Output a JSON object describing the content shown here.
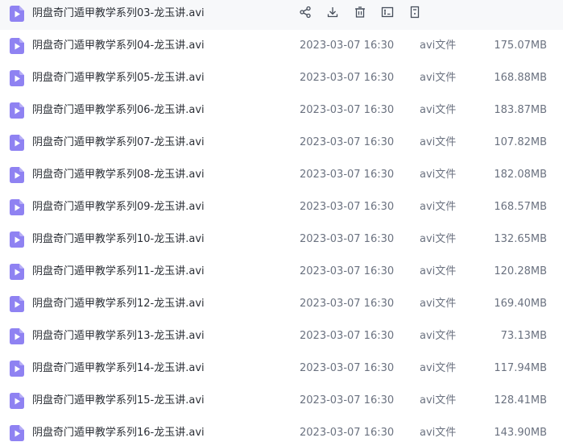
{
  "files": [
    {
      "name": "阴盘奇门遁甲教学系列03-龙玉讲.avi",
      "date": "",
      "type": "",
      "size": "",
      "hovered": true
    },
    {
      "name": "阴盘奇门遁甲教学系列04-龙玉讲.avi",
      "date": "2023-03-07 16:30",
      "type": "avi文件",
      "size": "175.07MB"
    },
    {
      "name": "阴盘奇门遁甲教学系列05-龙玉讲.avi",
      "date": "2023-03-07 16:30",
      "type": "avi文件",
      "size": "168.88MB"
    },
    {
      "name": "阴盘奇门遁甲教学系列06-龙玉讲.avi",
      "date": "2023-03-07 16:30",
      "type": "avi文件",
      "size": "183.87MB"
    },
    {
      "name": "阴盘奇门遁甲教学系列07-龙玉讲.avi",
      "date": "2023-03-07 16:30",
      "type": "avi文件",
      "size": "107.82MB"
    },
    {
      "name": "阴盘奇门遁甲教学系列08-龙玉讲.avi",
      "date": "2023-03-07 16:30",
      "type": "avi文件",
      "size": "182.08MB"
    },
    {
      "name": "阴盘奇门遁甲教学系列09-龙玉讲.avi",
      "date": "2023-03-07 16:30",
      "type": "avi文件",
      "size": "168.57MB"
    },
    {
      "name": "阴盘奇门遁甲教学系列10-龙玉讲.avi",
      "date": "2023-03-07 16:30",
      "type": "avi文件",
      "size": "132.65MB"
    },
    {
      "name": "阴盘奇门遁甲教学系列11-龙玉讲.avi",
      "date": "2023-03-07 16:30",
      "type": "avi文件",
      "size": "120.28MB"
    },
    {
      "name": "阴盘奇门遁甲教学系列12-龙玉讲.avi",
      "date": "2023-03-07 16:30",
      "type": "avi文件",
      "size": "169.40MB"
    },
    {
      "name": "阴盘奇门遁甲教学系列13-龙玉讲.avi",
      "date": "2023-03-07 16:30",
      "type": "avi文件",
      "size": "73.13MB"
    },
    {
      "name": "阴盘奇门遁甲教学系列14-龙玉讲.avi",
      "date": "2023-03-07 16:30",
      "type": "avi文件",
      "size": "117.94MB"
    },
    {
      "name": "阴盘奇门遁甲教学系列15-龙玉讲.avi",
      "date": "2023-03-07 16:30",
      "type": "avi文件",
      "size": "128.41MB"
    },
    {
      "name": "阴盘奇门遁甲教学系列16-龙玉讲.avi",
      "date": "2023-03-07 16:30",
      "type": "avi文件",
      "size": "143.90MB"
    }
  ],
  "hover_actions": [
    {
      "icon": "share-icon"
    },
    {
      "icon": "download-icon"
    },
    {
      "icon": "delete-icon"
    },
    {
      "icon": "rename-icon"
    },
    {
      "icon": "more-icon"
    }
  ],
  "colors": {
    "icon_purple": "#8f82f2",
    "hover_row": "#f7f8fa",
    "action_icon": "#454d5a"
  }
}
